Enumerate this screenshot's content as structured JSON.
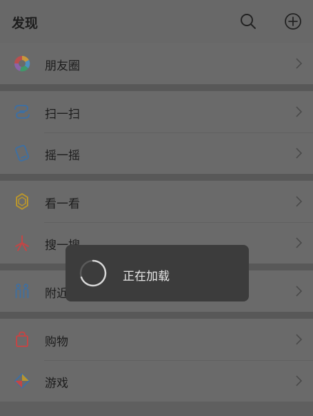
{
  "header": {
    "title": "发现"
  },
  "menu": {
    "moments": {
      "label": "朋友圈",
      "icon": "moments-icon"
    },
    "scan": {
      "label": "扫一扫",
      "icon": "scan-icon"
    },
    "shake": {
      "label": "摇一摇",
      "icon": "shake-icon"
    },
    "top_stories": {
      "label": "看一看",
      "icon": "top-stories-icon"
    },
    "search": {
      "label": "搜一搜",
      "icon": "search-sparkle-icon"
    },
    "nearby": {
      "label": "附近的人",
      "icon": "people-nearby-icon"
    },
    "shopping": {
      "label": "购物",
      "icon": "shopping-bag-icon"
    },
    "games": {
      "label": "游戏",
      "icon": "game-icon"
    }
  },
  "loading_toast": {
    "text": "正在加载"
  },
  "colors": {
    "overlay_background": "#5f5f5f",
    "toast_background": "#3c3c3c",
    "text": "#1c1c1c"
  }
}
